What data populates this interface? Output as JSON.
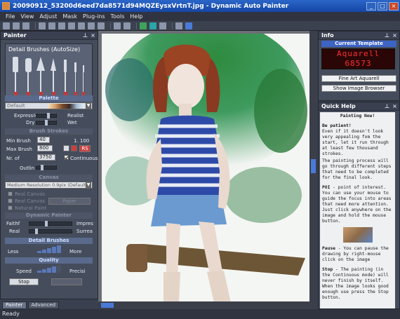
{
  "window": {
    "title": "20090912_53200d6eed7da8571d94MQZEysxVrtnT.jpg - Dynamic Auto Painter"
  },
  "menu": [
    "File",
    "View",
    "Adjust",
    "Mask",
    "Plug-ins",
    "Tools",
    "Help"
  ],
  "painter": {
    "title": "Painter",
    "preset": "Detail Brushes (AutoSize)",
    "palette_label": "Palette",
    "palette_select": "Default",
    "expressiv": "Expressiv",
    "realist": "Realist",
    "dry": "Dry",
    "wet": "Wet",
    "brush_strokes": "Brush Strokes",
    "min_brush_label": "Min Brush",
    "min_brush_value": "40",
    "ratio": "1. 100",
    "max_brush_label": "Max Brush",
    "max_brush_value": "800",
    "rs": "RS",
    "nr_of_label": "Nr. of",
    "nr_of_value": "3750",
    "continuous": "Continuous",
    "outlin": "Outlin",
    "canvas_label": "Canvas",
    "canvas_select": "Medium Resolution 0.9pix (Default)",
    "real_canvas": "Real Canvas",
    "real_canvas_b": "Real Canvas",
    "paper": "Paper",
    "natural_paint": "Natural Paint",
    "dynamic_painter": "Dynamic Painter",
    "faithf": "Faithf",
    "impres": "Impres",
    "real": "Real",
    "surrea": "Surrea",
    "detail_brushes": "Detail Brushes",
    "less": "Less",
    "more": "More",
    "quality": "Quality",
    "speed": "Speed",
    "precisi": "Precisi",
    "stop": "Stop",
    "stop_faded": "Faded"
  },
  "tabs": {
    "painter": "Painter",
    "advanced": "Advanced"
  },
  "info": {
    "title": "Info",
    "current_template": "Current Template",
    "led_top": "Aquarell",
    "led_bottom": "68573",
    "template_name": "Fine Art Aquarell",
    "show_image_browser": "Show Image Browser"
  },
  "quick_help": {
    "title": "Quick Help",
    "heading": "Painting Now!",
    "p1_bold": "Be patient!",
    "p1": "Even if it doesn't look very appealing fom the start, let it run through at least few thousand strokes.",
    "p2": "The painting process will go through different steps that need to be completed for the final look.",
    "p3_bold": "POI",
    "p3": " - point of interest. You can use your mouse to guide the focus into areas that need more attention. Just click anywhere on the image and hold the mouse button.",
    "p4_bold": "Pause",
    "p4": " - You can pause the drawing by right-mouse click on the image",
    "p5_bold": "Stop",
    "p5": " - The painting (in the Continuous mode) will never finish by itself. When the image looks good enough use press the Stop button."
  },
  "status": "Ready",
  "colors": {
    "accent": "#4a7ad8",
    "led": "#ff3030",
    "titlebar": "#1546a4"
  }
}
